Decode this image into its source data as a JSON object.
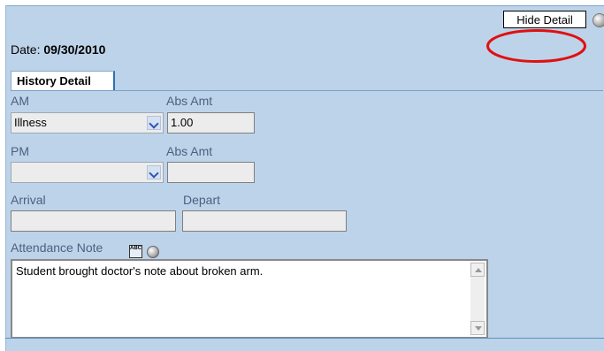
{
  "header": {
    "hide_detail_label": "Hide Detail"
  },
  "date": {
    "label": "Date:",
    "value": "09/30/2010"
  },
  "tab": {
    "label": "History Detail"
  },
  "am": {
    "label": "AM",
    "selected": "Illness",
    "abs_label": "Abs Amt",
    "abs_value": "1.00"
  },
  "pm": {
    "label": "PM",
    "selected": "",
    "abs_label": "Abs Amt",
    "abs_value": ""
  },
  "arrival": {
    "label": "Arrival",
    "value": ""
  },
  "depart": {
    "label": "Depart",
    "value": ""
  },
  "note": {
    "label": "Attendance Note",
    "spell_icon_text": "ABC",
    "value": "Student brought doctor's note about broken arm."
  },
  "colors": {
    "panel_bg": "#bdd3e9",
    "annotation": "#e01010",
    "tab_accent": "#2f6fb3"
  },
  "icons": [
    "info-circle-icon",
    "spell-check-icon",
    "check-circle-icon",
    "chevron-down-icon"
  ]
}
